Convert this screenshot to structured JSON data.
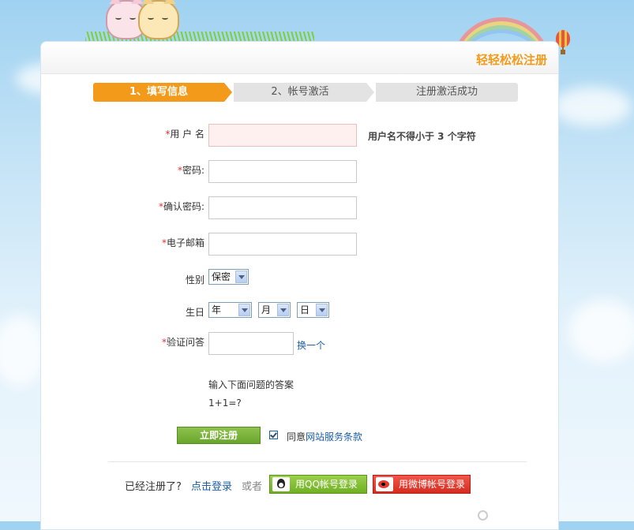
{
  "header": {
    "title": "轻轻松松注册"
  },
  "steps": [
    {
      "label": "1、填写信息",
      "active": true
    },
    {
      "label": "2、帐号激活",
      "active": false
    },
    {
      "label": "注册激活成功",
      "active": false
    }
  ],
  "form": {
    "required_mark": "*",
    "username": {
      "label": "用 户 名",
      "value": "",
      "hint": "用户名不得小于 3 个字符"
    },
    "password": {
      "label": "密码:",
      "value": ""
    },
    "confirm_password": {
      "label": "确认密码:",
      "value": ""
    },
    "email": {
      "label": "电子邮箱",
      "value": ""
    },
    "gender": {
      "label": "性别",
      "selected": "保密"
    },
    "birthday": {
      "label": "生日",
      "year": "年",
      "month": "月",
      "day": "日"
    },
    "captcha": {
      "label": "验证问答",
      "value": "",
      "refresh_link": "换一个"
    },
    "question_prompt": "输入下面问题的答案",
    "question": "1+1=?",
    "submit_label": "立即注册",
    "agree_prefix": "同意",
    "agree_link": "网站服务条款"
  },
  "footer": {
    "already_registered": "已经注册了?",
    "login_link": "点击登录",
    "or": "或者",
    "qq_login": "用QQ帐号登录",
    "weibo_login": "用微博帐号登录"
  },
  "colors": {
    "accent": "#f39a1a",
    "link": "#1c5fa5",
    "required": "#e23232",
    "submit": "#6aa52c",
    "qq": "#6fb022",
    "weibo": "#d52b1f"
  },
  "icons": [
    "cat-mascot-icon",
    "rainbow-icon",
    "hot-air-balloon-icon",
    "qq-penguin-icon",
    "weibo-eye-icon",
    "key-icon"
  ]
}
